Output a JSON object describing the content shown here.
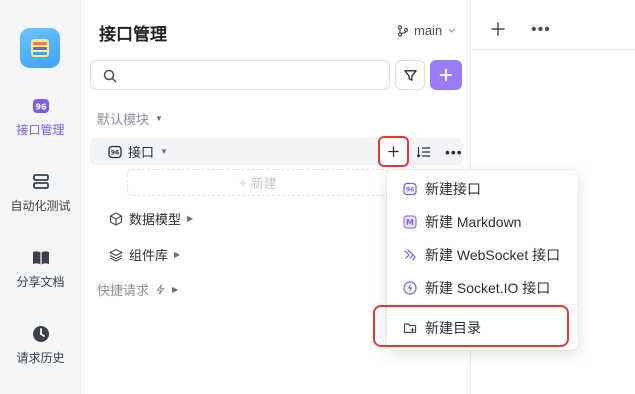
{
  "rail": {
    "items": [
      {
        "label": "接口管理",
        "icon": "api-icon",
        "active": true
      },
      {
        "label": "自动化测试",
        "icon": "automation-icon",
        "active": false
      },
      {
        "label": "分享文档",
        "icon": "book-icon",
        "active": false
      },
      {
        "label": "请求历史",
        "icon": "clock-icon",
        "active": false
      }
    ]
  },
  "panel": {
    "title": "接口管理",
    "branch": "main",
    "search_placeholder": "",
    "default_module": "默认模块",
    "tree": {
      "api_folder": "接口",
      "new_label": "新建",
      "data_models": "数据模型",
      "components": "组件库",
      "quick_requests": "快捷请求"
    }
  },
  "menu": {
    "items": [
      {
        "label": "新建接口",
        "icon": "api-icon"
      },
      {
        "label": "新建 Markdown",
        "icon": "markdown-icon"
      },
      {
        "label": "新建 WebSocket 接口",
        "icon": "websocket-icon"
      },
      {
        "label": "新建 Socket.IO 接口",
        "icon": "socketio-icon"
      },
      {
        "label": "新建目录",
        "icon": "folder-plus-icon"
      }
    ]
  },
  "colors": {
    "accent": "#7b5cf0",
    "accent_button": "#9b7cf6",
    "highlight_red": "#e03a3a",
    "rail_bg": "#f5f6f8"
  }
}
